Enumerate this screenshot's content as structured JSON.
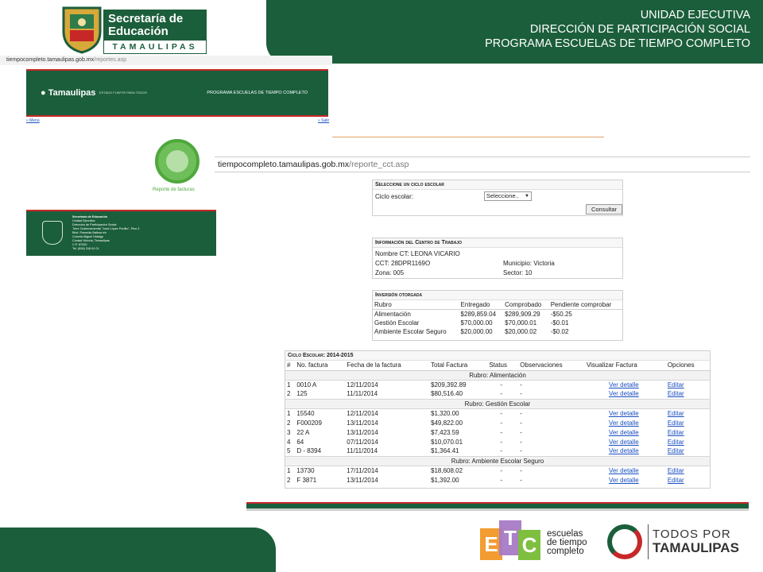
{
  "header": {
    "line1": "UNIDAD EJECUTIVA",
    "line2": "DIRECCIÓN DE PARTICIPACIÓN SOCIAL",
    "line3": "PROGRAMA ESCUELAS DE TIEMPO COMPLETO",
    "logo_title": "Secretaría de Educación",
    "logo_sub": "TAMAULIPAS"
  },
  "shot1": {
    "url_host": "tiempocompleto.tamaulipas.gob.mx",
    "url_path": "/reportes.asp",
    "brand": "Tamaulipas",
    "tagline": "ESTADO FUERTE PARA TODOS",
    "program": "PROGRAMA ESCUELAS DE TIEMPO COMPLETO",
    "menu_link": "« Menú",
    "salir_link": "» Salir",
    "report_label": "Reporte de facturas",
    "footer_lines": [
      "Secretaría de Educación",
      "Unidad Ejecutiva",
      "",
      "Dirección de Participación Social",
      "Torre Gubernamental \"José López Portillo\", Piso 3",
      "Blvd. Praxedis Balboa s/n",
      "Colonia Miguel Hidalgo",
      "Ciudad Victoria, Tamaulipas",
      "C.P. 87000",
      "Tel. (834) 318 61 01"
    ]
  },
  "shot2": {
    "url_host": "tiempocompleto.tamaulipas.gob.mx",
    "url_path": "/reporte_cct.asp"
  },
  "ciclo_panel": {
    "title": "Seleccione un ciclo escolar",
    "label": "Ciclo escolar:",
    "select_value": "Seleccione..",
    "button": "Consultar"
  },
  "info_panel": {
    "title": "Información del Centro de Trabajo",
    "nombre": "Nombre CT: LEONA VICARIO",
    "cct": "CCT: 28DPR1169O",
    "municipio": "Municipio: Victoria",
    "zona": "Zona: 005",
    "sector": "Sector: 10"
  },
  "inversion_panel": {
    "title": "Inversión otorgada",
    "headers": [
      "Rubro",
      "Entregado",
      "Comprobado",
      "Pendiente comprobar"
    ],
    "rows": [
      [
        "Alimentación",
        "$289,859.04",
        "$289,909.29",
        "-$50.25"
      ],
      [
        "Gestión Escolar",
        "$70,000.00",
        "$70,000.01",
        "-$0.01"
      ],
      [
        "Ambiente Escolar Seguro",
        "$20,000.00",
        "$20,000.02",
        "-$0.02"
      ]
    ]
  },
  "facturas_panel": {
    "title": "Ciclo Escolar: 2014-2015",
    "headers": [
      "#",
      "No. factura",
      "Fecha de la factura",
      "Total Factura",
      "Status",
      "Observaciones",
      "Visualizar Factura",
      "Opciones"
    ],
    "groups": [
      {
        "rubro": "Rubro: Alimentación",
        "rows": [
          [
            "1",
            "0010 A",
            "12/11/2014",
            "$209,392.89",
            "-",
            "-",
            "Ver detalle",
            "Editar"
          ],
          [
            "2",
            "125",
            "11/11/2014",
            "$80,516.40",
            "-",
            "-",
            "Ver detalle",
            "Editar"
          ]
        ]
      },
      {
        "rubro": "Rubro: Gestión Escolar",
        "rows": [
          [
            "1",
            "15540",
            "12/11/2014",
            "$1,320.00",
            "-",
            "-",
            "Ver detalle",
            "Editar"
          ],
          [
            "2",
            "F000209",
            "13/11/2014",
            "$49,822.00",
            "-",
            "-",
            "Ver detalle",
            "Editar"
          ],
          [
            "3",
            "22 A",
            "13/11/2014",
            "$7,423.59",
            "-",
            "-",
            "Ver detalle",
            "Editar"
          ],
          [
            "4",
            "64",
            "07/11/2014",
            "$10,070.01",
            "-",
            "-",
            "Ver detalle",
            "Editar"
          ],
          [
            "5",
            "D - 8394",
            "11/11/2014",
            "$1,364.41",
            "-",
            "-",
            "Ver detalle",
            "Editar"
          ]
        ]
      },
      {
        "rubro": "Rubro: Ambiente Escolar Seguro",
        "rows": [
          [
            "1",
            "13730",
            "17/11/2014",
            "$18,608.02",
            "-",
            "-",
            "Ver detalle",
            "Editar"
          ],
          [
            "2",
            "F 3871",
            "13/11/2014",
            "$1,392.00",
            "-",
            "-",
            "Ver detalle",
            "Editar"
          ]
        ]
      }
    ]
  },
  "footer": {
    "etc_text": [
      "escuelas",
      "de tiempo",
      "completo"
    ],
    "etc_letters": [
      "E",
      "T",
      "C"
    ],
    "todos_line1": "TODOS POR",
    "todos_line2": "TAMAULIPAS"
  },
  "colors": {
    "brand_green": "#1b5e3b",
    "accent_red": "#c62828",
    "link_blue": "#1a4fc0"
  }
}
